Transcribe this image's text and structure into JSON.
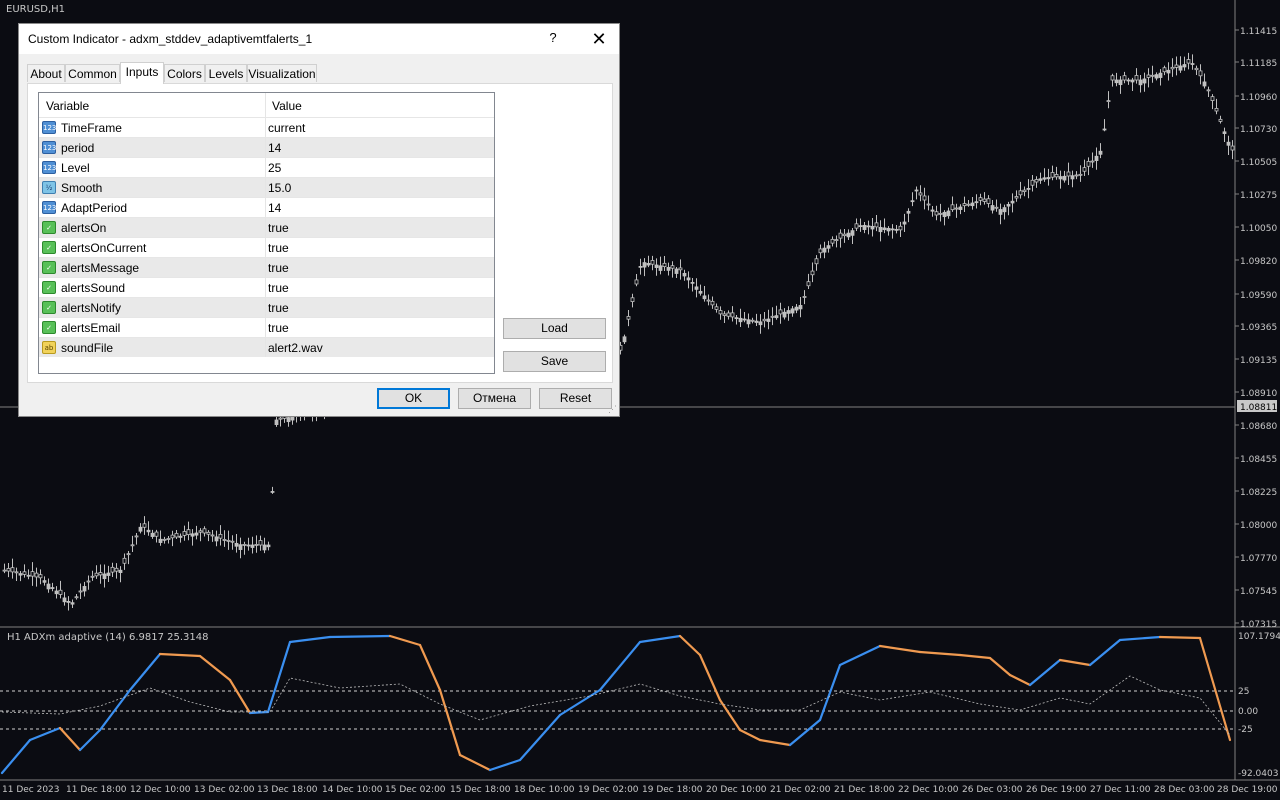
{
  "window": {
    "symbol": "EURUSD,H1",
    "indicator_label": "H1 ADXm adaptive (14) 6.9817 25.3148",
    "colors": {
      "background": "#0b0c12",
      "candle": "#c0c0c0",
      "adx_up": "#3a8ff0",
      "adx_down": "#f09a50"
    }
  },
  "price_axis": {
    "labels": [
      "1.11415",
      "1.11185",
      "1.10960",
      "1.10730",
      "1.10505",
      "1.10275",
      "1.10050",
      "1.09820",
      "1.09590",
      "1.09365",
      "1.09135",
      "1.08910",
      "1.08811",
      "1.08680",
      "1.08455",
      "1.08225",
      "1.08000",
      "1.07770",
      "1.07545",
      "1.07315"
    ],
    "current_price": "1.08811"
  },
  "indicator_axis": {
    "labels": [
      "107.1794",
      "25",
      "0.00",
      "-25",
      "-92.0403"
    ]
  },
  "time_axis": {
    "labels": [
      "11 Dec 2023",
      "11 Dec 18:00",
      "12 Dec 10:00",
      "13 Dec 02:00",
      "13 Dec 18:00",
      "14 Dec 10:00",
      "15 Dec 02:00",
      "15 Dec 18:00",
      "18 Dec 10:00",
      "19 Dec 02:00",
      "19 Dec 18:00",
      "20 Dec 10:00",
      "21 Dec 02:00",
      "21 Dec 18:00",
      "22 Dec 10:00",
      "26 Dec 03:00",
      "26 Dec 19:00",
      "27 Dec 11:00",
      "28 Dec 03:00",
      "28 Dec 19:00"
    ]
  },
  "dialog": {
    "title": "Custom Indicator - adxm_stddev_adaptivemtfalerts_1",
    "help": "?",
    "close": "✕",
    "tabs": [
      "About",
      "Common",
      "Inputs",
      "Colors",
      "Levels",
      "Visualization"
    ],
    "active_tab": "Inputs",
    "grid_headers": {
      "variable": "Variable",
      "value": "Value"
    },
    "params": [
      {
        "type": "int",
        "icon": "123",
        "name": "TimeFrame",
        "value": "current"
      },
      {
        "type": "int",
        "icon": "123",
        "name": "period",
        "value": "14"
      },
      {
        "type": "int",
        "icon": "123",
        "name": "Level",
        "value": "25"
      },
      {
        "type": "dbl",
        "icon": "½",
        "name": "Smooth",
        "value": "15.0"
      },
      {
        "type": "int",
        "icon": "123",
        "name": "AdaptPeriod",
        "value": "14"
      },
      {
        "type": "bool",
        "icon": "✓",
        "name": "alertsOn",
        "value": "true"
      },
      {
        "type": "bool",
        "icon": "✓",
        "name": "alertsOnCurrent",
        "value": "true"
      },
      {
        "type": "bool",
        "icon": "✓",
        "name": "alertsMessage",
        "value": "true"
      },
      {
        "type": "bool",
        "icon": "✓",
        "name": "alertsSound",
        "value": "true"
      },
      {
        "type": "bool",
        "icon": "✓",
        "name": "alertsNotify",
        "value": "true"
      },
      {
        "type": "bool",
        "icon": "✓",
        "name": "alertsEmail",
        "value": "true"
      },
      {
        "type": "str",
        "icon": "ab",
        "name": "soundFile",
        "value": "alert2.wav"
      }
    ],
    "buttons": {
      "load": "Load",
      "save": "Save",
      "ok": "OK",
      "cancel": "Отмена",
      "reset": "Reset"
    }
  }
}
